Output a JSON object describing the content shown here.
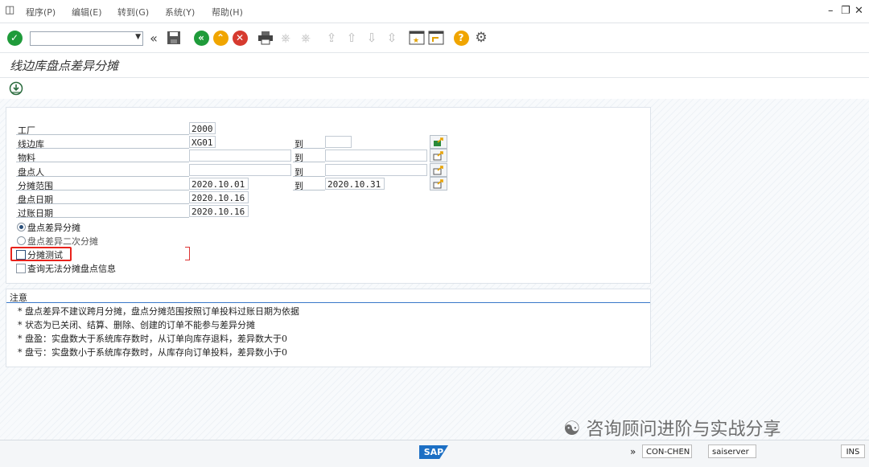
{
  "menu": {
    "items": [
      {
        "label": "程序(P)"
      },
      {
        "label": "编辑(E)"
      },
      {
        "label": "转到(G)"
      },
      {
        "label": "系统(Y)"
      },
      {
        "label": "帮助(H)"
      }
    ]
  },
  "toolbar": {
    "command_value": "",
    "icons": [
      "enter-icon",
      "back-history-icon",
      "save-icon",
      "back-icon",
      "exit-icon",
      "cancel-icon",
      "print-icon",
      "find-icon",
      "find-next-icon",
      "first-page-icon",
      "previous-page-icon",
      "next-page-icon",
      "last-page-icon",
      "create-session-icon",
      "shortcut-icon",
      "help-icon",
      "settings-icon"
    ]
  },
  "title": "线边库盘点差异分摊",
  "selection": {
    "to_label": "到",
    "rows": [
      {
        "label": "工厂",
        "from": "2000"
      },
      {
        "label": "线边库",
        "from": "XG01",
        "to": ""
      },
      {
        "label": "物料",
        "from": "",
        "to": ""
      },
      {
        "label": "盘点人",
        "from": "",
        "to": ""
      },
      {
        "label": "分摊范围",
        "from": "2020.10.01",
        "to": "2020.10.31"
      },
      {
        "label": "盘点日期",
        "from": "2020.10.16"
      },
      {
        "label": "过账日期",
        "from": "2020.10.16"
      }
    ],
    "radios": [
      {
        "label": "盘点差异分摊",
        "selected": true
      },
      {
        "label": "盘点差异二次分摊",
        "selected": false
      }
    ],
    "checkboxes": [
      {
        "label": "分摊测试",
        "checked": false
      },
      {
        "label": "查询无法分摊盘点信息",
        "checked": false
      }
    ]
  },
  "notes": {
    "title": "注意",
    "lines": [
      "*  盘点差异不建议跨月分摊，盘点分摊范围按照订单投料过账日期为依据",
      "*  状态为已关闭、结算、删除、创建的订单不能参与差异分摊",
      "*  盘盈：实盘数大于系统库存数时，从订单向库存退料，差异数大于0",
      "*  盘亏：实盘数小于系统库存数时，从库存向订单投料，差异数小于0"
    ]
  },
  "status": {
    "sap_logo": "SAP",
    "arrow": "»",
    "system": "CON-CHEN",
    "server": "saiserver",
    "mode": "INS"
  },
  "watermark": "咨询顾问进阶与实战分享",
  "colors": {
    "accent_green": "#1f9b3a",
    "orange": "#f0a500",
    "red": "#d63a2f",
    "highlight": "#e8231c"
  }
}
